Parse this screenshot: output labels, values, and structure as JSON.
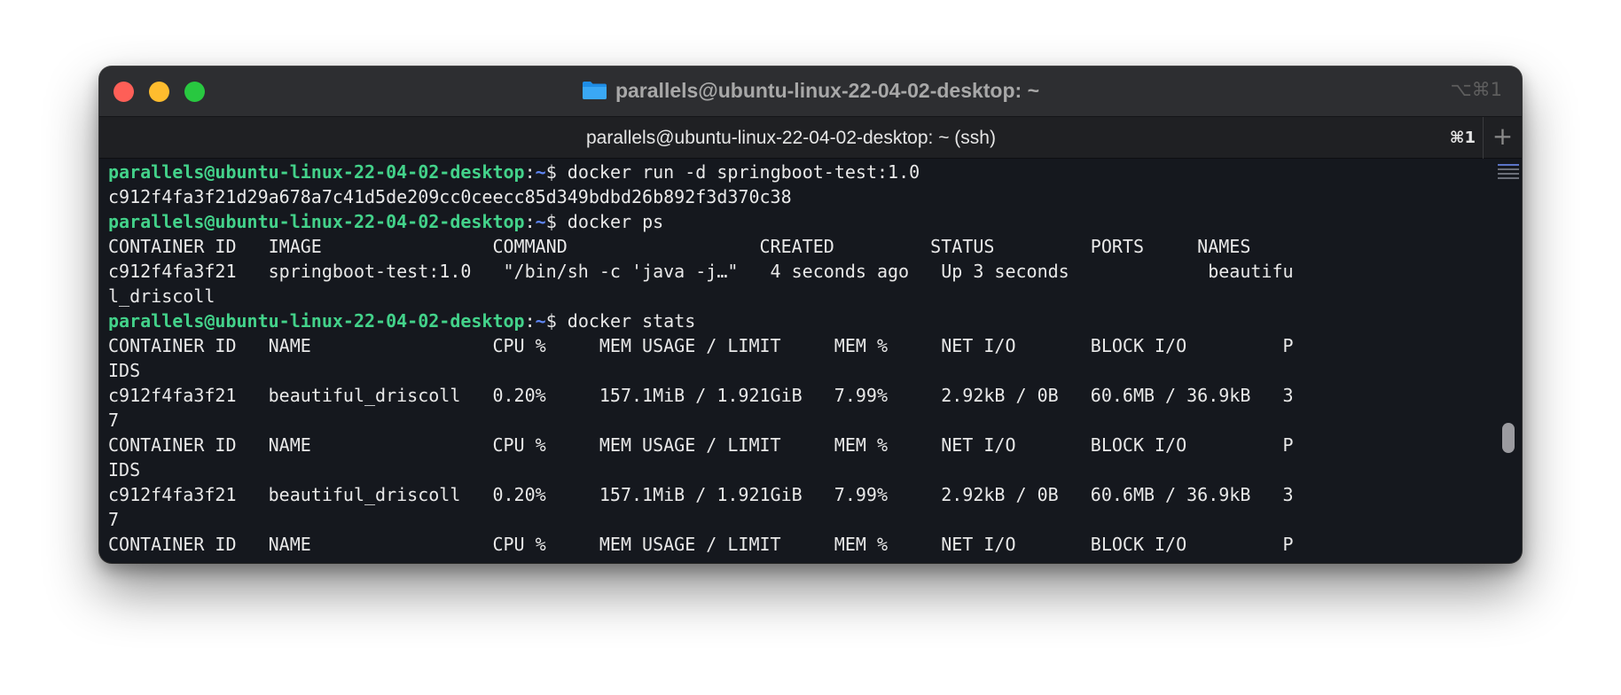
{
  "window": {
    "title": "parallels@ubuntu-linux-22-04-02-desktop: ~",
    "shortcut": "⌥⌘1"
  },
  "tab": {
    "title": "parallels@ubuntu-linux-22-04-02-desktop: ~ (ssh)",
    "shortcut": "⌘1",
    "new_tab_label": "+"
  },
  "terminal": {
    "prompt": {
      "user_host": "parallels@ubuntu-linux-22-04-02-desktop",
      "separator": ":",
      "path": "~",
      "symbol": "$ "
    },
    "commands": {
      "run": "docker run -d springboot-test:1.0",
      "ps": "docker ps",
      "stats": "docker stats"
    },
    "run_output": "c912f4fa3f21d29a678a7c41d5de209cc0ceecc85d349bdbd26b892f3d370c38",
    "ps_header": "CONTAINER ID   IMAGE                COMMAND                  CREATED         STATUS         PORTS     NAMES",
    "ps_row": "c912f4fa3f21   springboot-test:1.0   \"/bin/sh -c 'java -j…\"   4 seconds ago   Up 3 seconds             beautifu",
    "ps_row_wrap": "l_driscoll",
    "stats_header": "CONTAINER ID   NAME                 CPU %     MEM USAGE / LIMIT     MEM %     NET I/O       BLOCK I/O         P",
    "stats_header_wrap": "IDS",
    "stats_row": "c912f4fa3f21   beautiful_driscoll   0.20%     157.1MiB / 1.921GiB   7.99%     2.92kB / 0B   60.6MB / 36.9kB   3",
    "stats_row_wrap": "7"
  },
  "colors": {
    "prompt_user": "#43d28a",
    "prompt_path": "#5f86f5",
    "terminal_bg": "#15181e",
    "text": "#e9e9e9"
  }
}
